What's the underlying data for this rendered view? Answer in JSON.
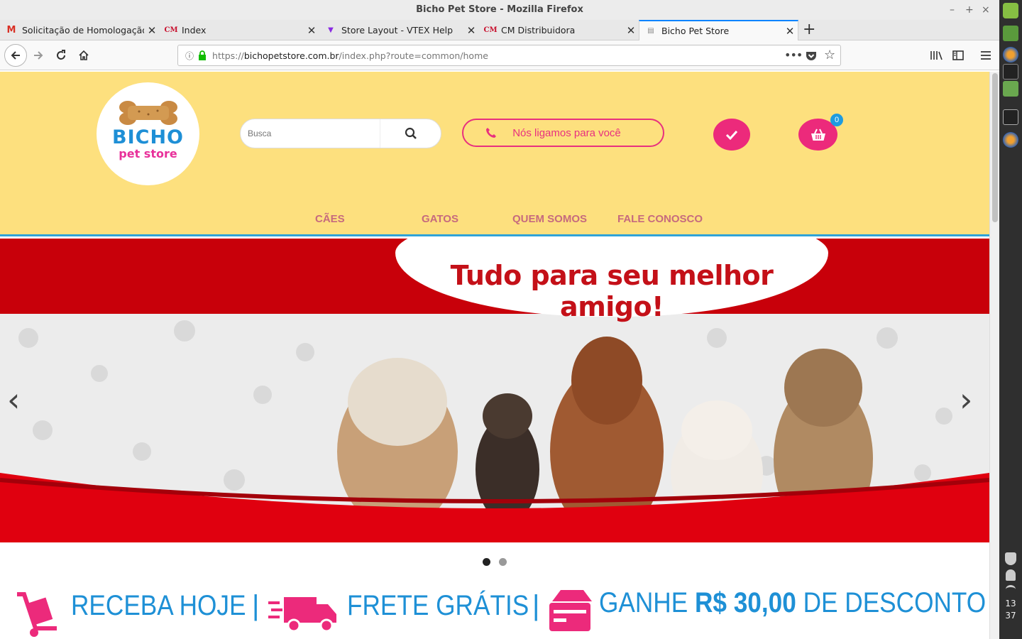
{
  "window": {
    "title": "Bicho Pet Store - Mozilla Firefox",
    "controls": {
      "minimize": "–",
      "maximize": "+",
      "close": "×"
    }
  },
  "tabs": [
    {
      "label": "Solicitação de Homologação (",
      "favicon": "M",
      "favicon_color": "#d93025",
      "icon": "gmail-icon"
    },
    {
      "label": "Index",
      "favicon": "CM",
      "favicon_color": "#c8102e",
      "icon": "cm-icon"
    },
    {
      "label": "Store Layout - VTEX Help",
      "favicon": "▼",
      "favicon_color": "#8a2be2",
      "icon": "vtex-icon"
    },
    {
      "label": "CM Distribuidora",
      "favicon": "CM",
      "favicon_color": "#c8102e",
      "icon": "cm-icon"
    },
    {
      "label": "Bicho Pet Store",
      "favicon": "▤",
      "favicon_color": "#888888",
      "icon": "page-icon"
    }
  ],
  "active_tab_index": 4,
  "new_tab": "+",
  "url": {
    "prefix": "https://",
    "host": "bichopetstore.com.br",
    "path": "/index.php?route=common/home"
  },
  "store": {
    "logo": {
      "line1": "BICHO",
      "line2": "pet store"
    },
    "search_placeholder": "Busca",
    "call_label": "Nós ligamos para você",
    "cart_count": "0",
    "menu": [
      "CÃES",
      "GATOS",
      "QUEM SOMOS",
      "FALE CONOSCO"
    ],
    "banner": {
      "slogan": "Tudo para seu melhor amigo!",
      "slides": 2,
      "active_slide": 0,
      "prev": "‹",
      "next": "›"
    },
    "promo": {
      "item1": "RECEBA HOJE",
      "item2": "FRETE GRÁTIS",
      "item3_a": "GANHE ",
      "item3_b": "R$ 30,00",
      "item3_c": " DE DESCONTO",
      "separator": "|"
    },
    "colors": {
      "header_bg": "#fde07e",
      "accent_pink": "#ec2a7b",
      "accent_blue": "#1e90d6",
      "banner_red": "#c8000a"
    }
  },
  "clock": {
    "hour": "13",
    "minute": "37"
  }
}
